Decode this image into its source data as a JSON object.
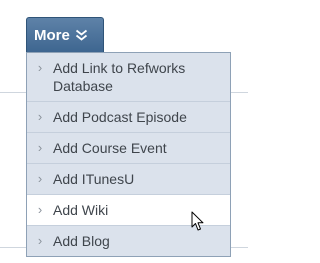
{
  "menu_button": {
    "label": "More",
    "icon": "double-chevron-down-icon"
  },
  "menu": {
    "items": [
      {
        "label": "Add Link to Refworks Database",
        "state": "normal"
      },
      {
        "label": "Add Podcast Episode",
        "state": "normal"
      },
      {
        "label": "Add Course Event",
        "state": "normal"
      },
      {
        "label": "Add ITunesU",
        "state": "normal"
      },
      {
        "label": "Add Wiki",
        "state": "hover"
      },
      {
        "label": "Add Blog",
        "state": "normal"
      }
    ],
    "item_icon": "caret-right-icon",
    "caret_glyph": "›"
  },
  "pointer": {
    "icon": "mouse-pointer-icon"
  },
  "colors": {
    "tab_background": "#4a729a",
    "menu_background": "#dbe2ec",
    "hover_background": "#ffffff",
    "item_text": "#3f454c"
  }
}
